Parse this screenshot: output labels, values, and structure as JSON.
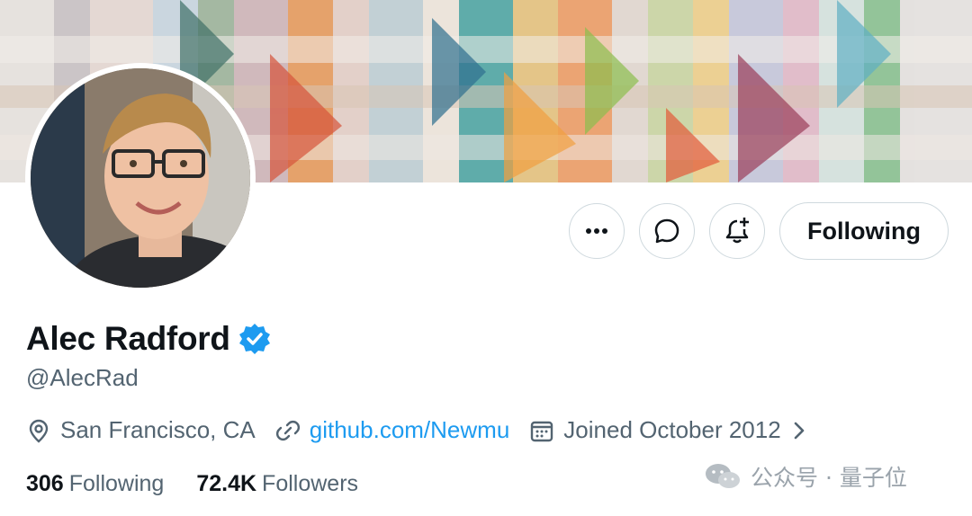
{
  "profile": {
    "name": "Alec Radford",
    "handle": "@AlecRad",
    "verified": true,
    "location": "San Francisco, CA",
    "website": "github.com/Newmu",
    "joined": "Joined October 2012",
    "following_count": "306",
    "following_label": "Following",
    "followers_count": "72.4K",
    "followers_label": "Followers"
  },
  "actions": {
    "more_icon": "more-icon",
    "message_icon": "message-icon",
    "notify_icon": "bell-plus-icon",
    "follow_button_label": "Following"
  },
  "watermark": {
    "text": "公众号 · 量子位"
  },
  "colors": {
    "accent": "#1d9bf0",
    "text_primary": "#0f1419",
    "text_secondary": "#536471",
    "border": "#cfd9de"
  }
}
